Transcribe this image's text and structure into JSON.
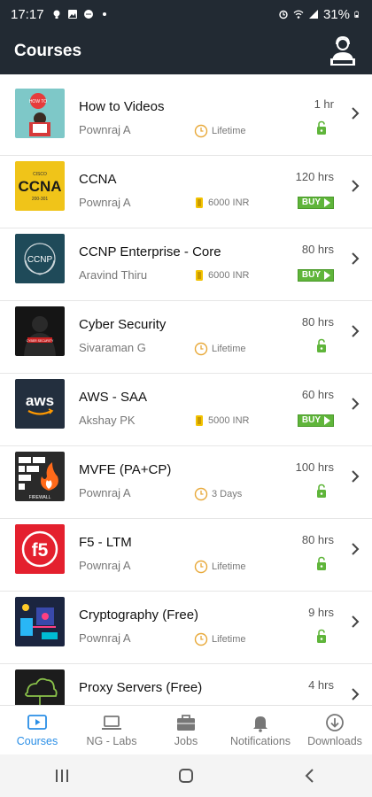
{
  "status": {
    "time": "17:17",
    "battery": "31%",
    "icons": [
      "bulb-icon",
      "image-icon",
      "chat-icon",
      "dot-icon",
      "alarm-icon",
      "wifi-icon",
      "signal-icon",
      "battery-icon"
    ]
  },
  "header": {
    "title": "Courses",
    "support_icon": "support-agent-icon"
  },
  "courses": [
    {
      "title": "How to Videos",
      "instructor": "Pownraj A",
      "duration": "1 hr",
      "meta": "Lifetime",
      "meta_icon": "clock-icon",
      "status": "unlocked",
      "thumb": "howto"
    },
    {
      "title": "CCNA",
      "instructor": "Pownraj A",
      "duration": "120 hrs",
      "meta": "6000 INR",
      "meta_icon": "coin-icon",
      "status": "buy",
      "thumb": "ccna"
    },
    {
      "title": "CCNP Enterprise - Core",
      "instructor": "Aravind Thiru",
      "duration": "80 hrs",
      "meta": "6000 INR",
      "meta_icon": "coin-icon",
      "status": "buy",
      "thumb": "ccnp"
    },
    {
      "title": "Cyber Security",
      "instructor": "Sivaraman G",
      "duration": "80 hrs",
      "meta": "Lifetime",
      "meta_icon": "clock-icon",
      "status": "unlocked",
      "thumb": "cyber"
    },
    {
      "title": "AWS - SAA",
      "instructor": "Akshay PK",
      "duration": "60 hrs",
      "meta": "5000 INR",
      "meta_icon": "coin-icon",
      "status": "buy",
      "thumb": "aws"
    },
    {
      "title": "MVFE (PA+CP)",
      "instructor": "Pownraj A",
      "duration": "100 hrs",
      "meta": "3 Days",
      "meta_icon": "clock-icon",
      "status": "unlocked",
      "thumb": "firewall"
    },
    {
      "title": "F5 - LTM",
      "instructor": "Pownraj A",
      "duration": "80 hrs",
      "meta": "Lifetime",
      "meta_icon": "clock-icon",
      "status": "unlocked",
      "thumb": "f5"
    },
    {
      "title": "Cryptography (Free)",
      "instructor": "Pownraj A",
      "duration": "9 hrs",
      "meta": "Lifetime",
      "meta_icon": "clock-icon",
      "status": "unlocked",
      "thumb": "crypto"
    },
    {
      "title": "Proxy Servers (Free)",
      "instructor": "",
      "duration": "4 hrs",
      "meta": "",
      "meta_icon": "",
      "status": "",
      "thumb": "proxy"
    }
  ],
  "thumb_text": {
    "howto_label": "HOW TO",
    "ccna_top": "CISCO",
    "ccna_main": "CCNA",
    "ccna_sub": "200-301",
    "ccnp_main": "CCNP",
    "aws_main": "aws",
    "firewall_label": "FIREWALL",
    "f5_main": "f5",
    "cyber_label": "CYBER SECURITY"
  },
  "buy_label": "BUY",
  "nav": {
    "items": [
      {
        "label": "Courses",
        "icon": "play-video-icon",
        "active": true
      },
      {
        "label": "NG - Labs",
        "icon": "laptop-icon",
        "active": false
      },
      {
        "label": "Jobs",
        "icon": "briefcase-icon",
        "active": false
      },
      {
        "label": "Notifications",
        "icon": "bell-icon",
        "active": false
      },
      {
        "label": "Downloads",
        "icon": "download-icon",
        "active": false
      }
    ]
  },
  "system_nav": [
    "recents-icon",
    "home-icon",
    "back-icon"
  ],
  "colors": {
    "appbar": "#222a33",
    "accent": "#2a8ee6",
    "buy": "#5fb53a",
    "unlock": "#5fb53a"
  }
}
